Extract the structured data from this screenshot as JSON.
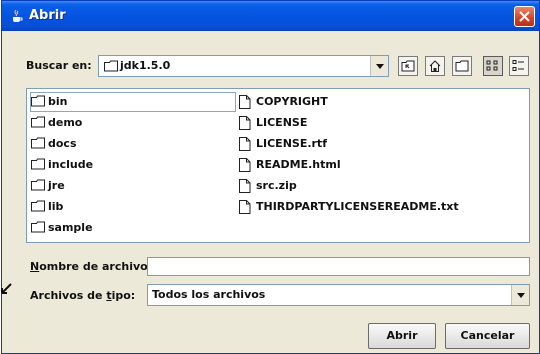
{
  "window": {
    "title": "Abrir"
  },
  "lookin": {
    "label": "Buscar en:",
    "value": "jdk1.5.0"
  },
  "toolbar": [
    {
      "name": "up-one-level-button",
      "icon": "folder-up-icon"
    },
    {
      "name": "home-button",
      "icon": "home-icon"
    },
    {
      "name": "new-folder-button",
      "icon": "new-folder-icon"
    },
    {
      "name": "list-view-button",
      "icon": "list-view-icon"
    },
    {
      "name": "details-view-button",
      "icon": "details-view-icon"
    }
  ],
  "files": {
    "folders": [
      "bin",
      "demo",
      "docs",
      "include",
      "jre",
      "lib",
      "sample"
    ],
    "documents": [
      "COPYRIGHT",
      "LICENSE",
      "LICENSE.rtf",
      "README.html",
      "src.zip",
      "THIRDPARTYLICENSEREADME.txt"
    ]
  },
  "filename": {
    "label_first": "N",
    "label_rest": "ombre de archivo:",
    "value": ""
  },
  "filetype": {
    "label_prefix": "Archivos de ",
    "label_mnemonic": "t",
    "label_suffix": "ipo:",
    "value": "Todos los archivos"
  },
  "buttons": {
    "open": "Abrir",
    "cancel": "Cancelar"
  },
  "colors": {
    "titlebar": "#0453e0",
    "window_bg": "#ece9d8",
    "close": "#d1442a"
  }
}
